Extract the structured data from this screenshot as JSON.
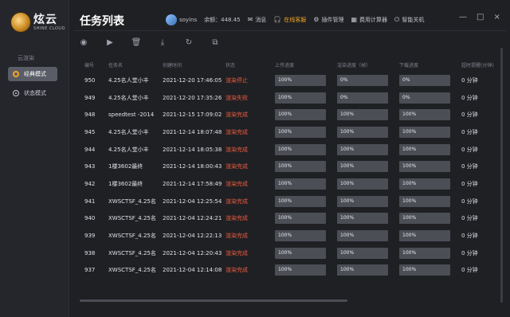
{
  "app": {
    "logo_main": "炫云",
    "logo_sub": "SHINE CLOUD",
    "section_label": "云渲染",
    "nav": [
      {
        "label": "经典模式",
        "active": true
      },
      {
        "label": "状态模式",
        "active": false
      }
    ]
  },
  "page": {
    "title": "任务列表"
  },
  "header": {
    "username": "soyins",
    "balance": "余额：448.45",
    "messages": "消息",
    "support": "在线客服",
    "plugins": "插件管理",
    "fee_calc": "费用计算器",
    "smart_shutdown": "智能关机"
  },
  "window_controls": [
    "—",
    "□",
    "×"
  ],
  "toolbar": [
    "play-circle-icon",
    "play-icon",
    "trash-icon",
    "download-icon",
    "refresh-icon",
    "copy-icon"
  ],
  "columns": [
    "编号",
    "任务名",
    "创建时间",
    "状态",
    "上传进度",
    "渲染进度（帧）",
    "下载进度",
    "超时提醒(分钟)"
  ],
  "rows": [
    {
      "id": "950",
      "name": "4.25名人堂小丰",
      "time": "2021-12-20 17:46:05",
      "status": "渲染停止",
      "upload": "100%",
      "render": "0%",
      "download": "0%",
      "overtime": "0 分钟"
    },
    {
      "id": "949",
      "name": "4.25名人堂小丰",
      "time": "2021-12-20 17:35:26",
      "status": "渲染失败",
      "upload": "100%",
      "render": "0%",
      "download": "0%",
      "overtime": "0 分钟"
    },
    {
      "id": "948",
      "name": "speedtest -2014",
      "time": "2021-12-15 17:09:02",
      "status": "渲染完成",
      "upload": "100%",
      "render": "100%",
      "download": "100%",
      "overtime": "0 分钟"
    },
    {
      "id": "945",
      "name": "4.25名人堂小丰",
      "time": "2021-12-14 18:07:48",
      "status": "渲染完成",
      "upload": "100%",
      "render": "100%",
      "download": "100%",
      "overtime": "0 分钟"
    },
    {
      "id": "944",
      "name": "4.25名人堂小丰",
      "time": "2021-12-14 18:05:38",
      "status": "渲染完成",
      "upload": "100%",
      "render": "100%",
      "download": "100%",
      "overtime": "0 分钟"
    },
    {
      "id": "943",
      "name": "1楼3602最终",
      "time": "2021-12-14 18:00:43",
      "status": "渲染完成",
      "upload": "100%",
      "render": "100%",
      "download": "100%",
      "overtime": "0 分钟"
    },
    {
      "id": "942",
      "name": "1楼3602最终",
      "time": "2021-12-14 17:58:49",
      "status": "渲染完成",
      "upload": "100%",
      "render": "100%",
      "download": "100%",
      "overtime": "0 分钟"
    },
    {
      "id": "941",
      "name": "XWSCTSF_4.25名",
      "time": "2021-12-04 12:25:54",
      "status": "渲染完成",
      "upload": "100%",
      "render": "100%",
      "download": "100%",
      "overtime": "0 分钟"
    },
    {
      "id": "940",
      "name": "XWSCTSF_4.25名",
      "time": "2021-12-04 12:24:21",
      "status": "渲染完成",
      "upload": "100%",
      "render": "100%",
      "download": "100%",
      "overtime": "0 分钟"
    },
    {
      "id": "939",
      "name": "XWSCTSF_4.25名",
      "time": "2021-12-04 12:22:13",
      "status": "渲染完成",
      "upload": "100%",
      "render": "100%",
      "download": "100%",
      "overtime": "0 分钟"
    },
    {
      "id": "938",
      "name": "XWSCTSF_4.25名",
      "time": "2021-12-04 12:20:43",
      "status": "渲染完成",
      "upload": "100%",
      "render": "100%",
      "download": "100%",
      "overtime": "0 分钟"
    },
    {
      "id": "937",
      "name": "XWSCTSF_4.25名",
      "time": "2021-12-04 12:14:08",
      "status": "渲染完成",
      "upload": "100%",
      "render": "100%",
      "download": "100%",
      "overtime": "0 分钟"
    }
  ]
}
